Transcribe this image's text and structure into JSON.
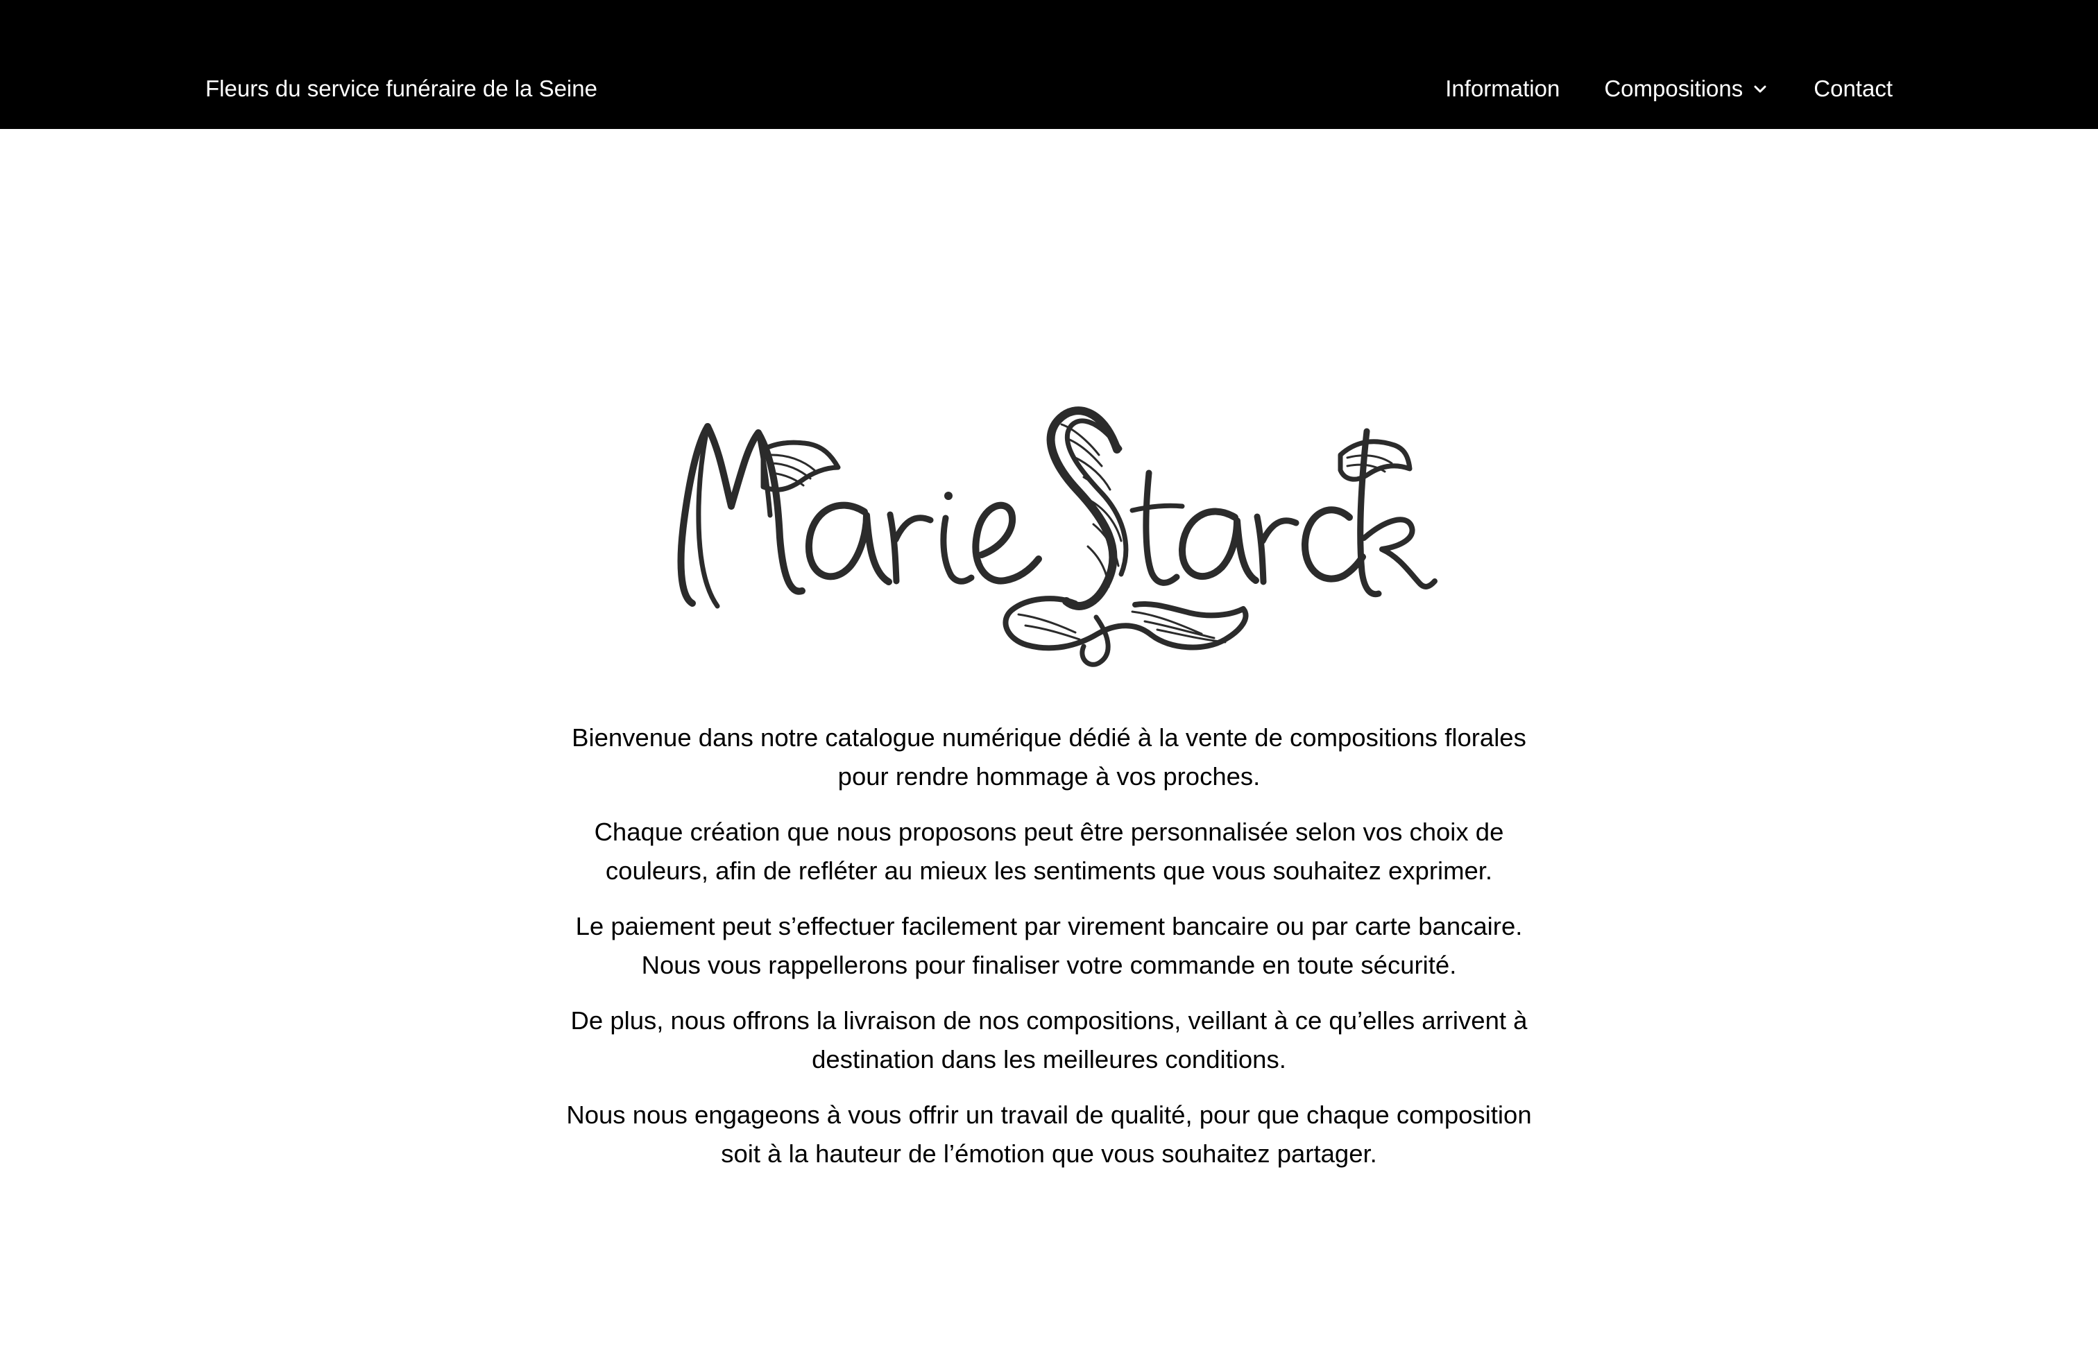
{
  "header": {
    "site_title": "Fleurs du service funéraire de la Seine",
    "background_color": "#000000",
    "text_color": "#ffffff",
    "nav": [
      {
        "label": "Information"
      },
      {
        "label": "Compositions",
        "icon": "chevron-down-icon"
      },
      {
        "label": "Contact"
      }
    ]
  },
  "logo": {
    "text": "MarieStarck",
    "color": "#2b2b2b"
  },
  "main": {
    "paragraphs": [
      {
        "line1": "Bienvenue dans notre catalogue numérique dédié à la vente de compositions florales",
        "line2": "pour rendre hommage à vos proches."
      },
      {
        "line1": "Chaque création que nous proposons peut être personnalisée selon vos choix de",
        "line2": "couleurs, afin de refléter au mieux les sentiments que vous souhaitez exprimer."
      },
      {
        "line1": "Le paiement peut s’effectuer facilement par virement bancaire ou par carte bancaire.",
        "line2": "Nous vous rappellerons pour finaliser votre commande en toute sécurité."
      },
      {
        "line1": "De plus, nous offrons la livraison de nos compositions, veillant à ce qu’elles arrivent à",
        "line2": "destination dans les meilleures conditions."
      },
      {
        "line1": "Nous nous engageons à vous offrir un travail de qualité, pour que chaque composition",
        "line2": "soit à la hauteur de l’émotion que vous souhaitez partager."
      }
    ]
  }
}
